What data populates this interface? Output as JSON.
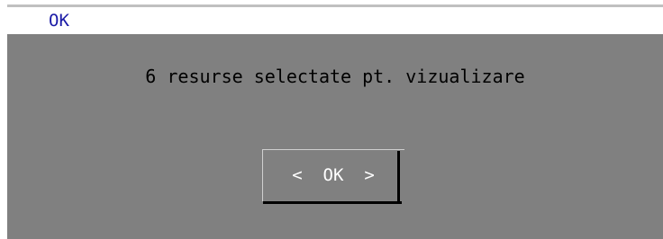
{
  "window": {
    "title": "OK"
  },
  "dialog": {
    "message": "6 resurse selectate pt. vizualizare",
    "ok_button": {
      "left_marker": "<",
      "label": "OK",
      "right_marker": ">"
    }
  },
  "colors": {
    "title_text": "#1a1aa6",
    "dialog_background": "#808080",
    "button_text": "#ffffff",
    "message_text": "#000000"
  }
}
